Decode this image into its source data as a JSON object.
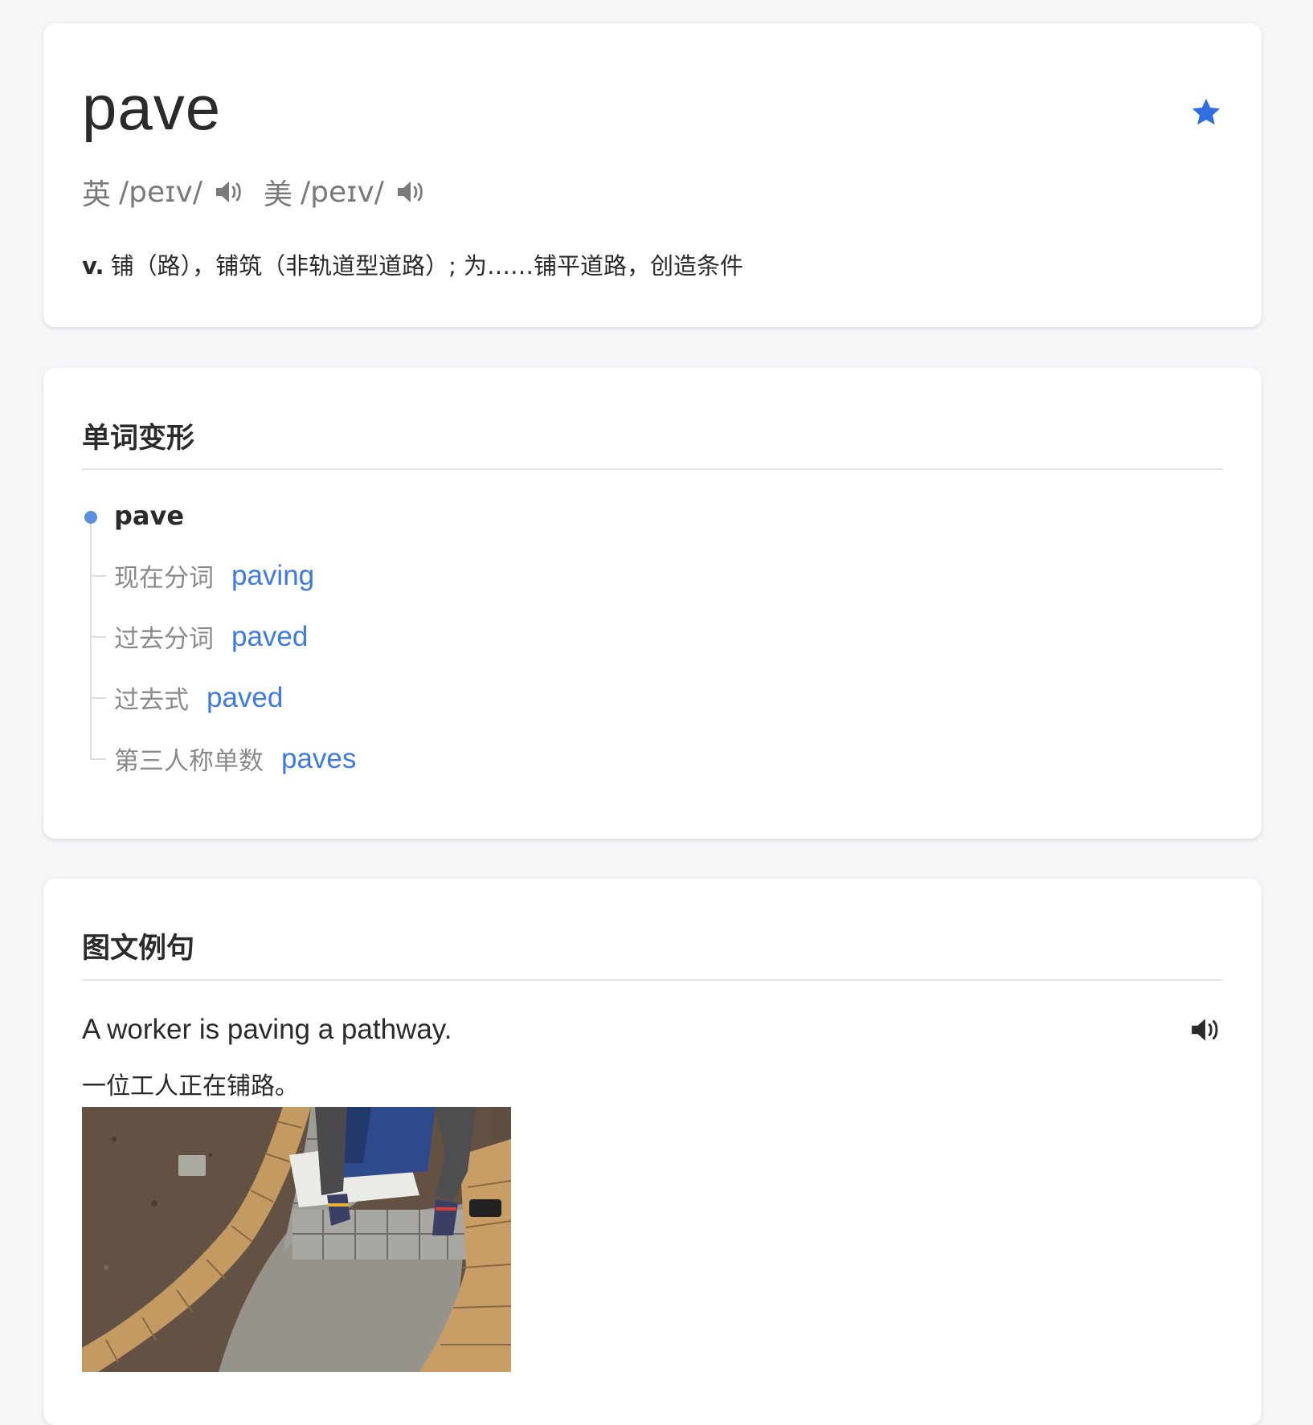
{
  "colors": {
    "accent": "#3d7be0",
    "star": "#2f6fe0",
    "muted": "#7a7a7a",
    "text": "#2b2b2b",
    "background": "#f5f6f8"
  },
  "word": {
    "headword": "pave",
    "favorite_icon": "star-icon",
    "favorited": true,
    "phonetics": [
      {
        "region": "英",
        "ipa": "/peɪv/",
        "icon": "speaker-icon"
      },
      {
        "region": "美",
        "ipa": "/peɪv/",
        "icon": "speaker-icon"
      }
    ],
    "definition": {
      "pos": "v.",
      "text": "铺（路），铺筑（非轨道型道路）; 为……铺平道路，创造条件"
    }
  },
  "forms": {
    "title": "单词变形",
    "base": "pave",
    "items": [
      {
        "label": "现在分词",
        "value": "paving"
      },
      {
        "label": "过去分词",
        "value": "paved"
      },
      {
        "label": "过去式",
        "value": "paved"
      },
      {
        "label": "第三人称单数",
        "value": "paves"
      }
    ]
  },
  "examples": {
    "title": "图文例句",
    "items": [
      {
        "en": "A worker is paving a pathway.",
        "zh": "一位工人正在铺路。",
        "icon": "speaker-icon"
      }
    ]
  }
}
